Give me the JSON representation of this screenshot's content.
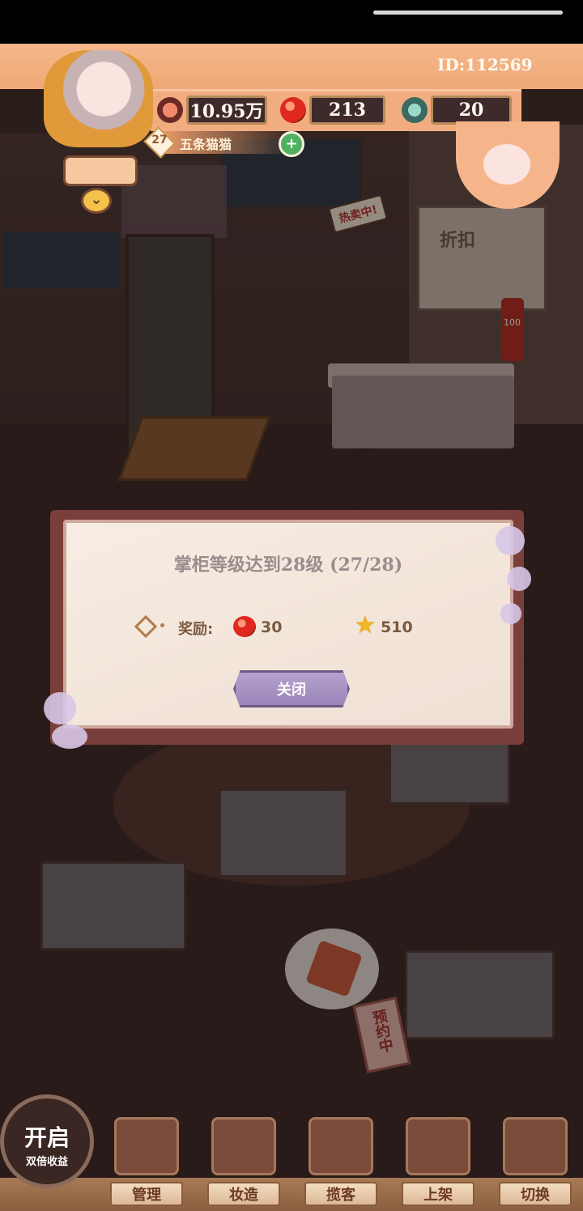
{
  "hud": {
    "player_id": "ID:112569",
    "level": "27",
    "player_name": "五条猫猫",
    "resources": [
      {
        "name": "coins",
        "value": "10.95万",
        "icon": "coin-bag-icon"
      },
      {
        "name": "gems",
        "value": "213",
        "icon": "red-gem-icon"
      },
      {
        "name": "energy",
        "value": "20",
        "icon": "energy-orb-icon"
      }
    ]
  },
  "scene": {
    "hot_sale_badge": "热卖中!",
    "price_tag": "100",
    "reserve_sign": "预约中"
  },
  "modal": {
    "title": "掌柜等级达到28级 (27/28)",
    "reward_label": "奖励:",
    "rewards": [
      {
        "icon": "red-gem-icon",
        "amount": "30"
      },
      {
        "icon": "star-icon",
        "amount": "510"
      }
    ],
    "close_button": "关闭"
  },
  "bottom_nav": {
    "double_button": {
      "main": "开启",
      "sub": "双倍收益"
    },
    "items": [
      {
        "label": "管理",
        "icon": "manage-icon"
      },
      {
        "label": "妆造",
        "icon": "makeup-icon"
      },
      {
        "label": "揽客",
        "icon": "attract-customer-icon"
      },
      {
        "label": "上架",
        "icon": "shelf-icon"
      },
      {
        "label": "切换",
        "icon": "switch-icon"
      }
    ]
  },
  "colors": {
    "hud_orange": "#f0a877",
    "modal_bg": "#f6ede4",
    "close_button_purple": "#9a86b8",
    "gem_red": "#e0281f",
    "star_gold": "#f2b51f"
  }
}
